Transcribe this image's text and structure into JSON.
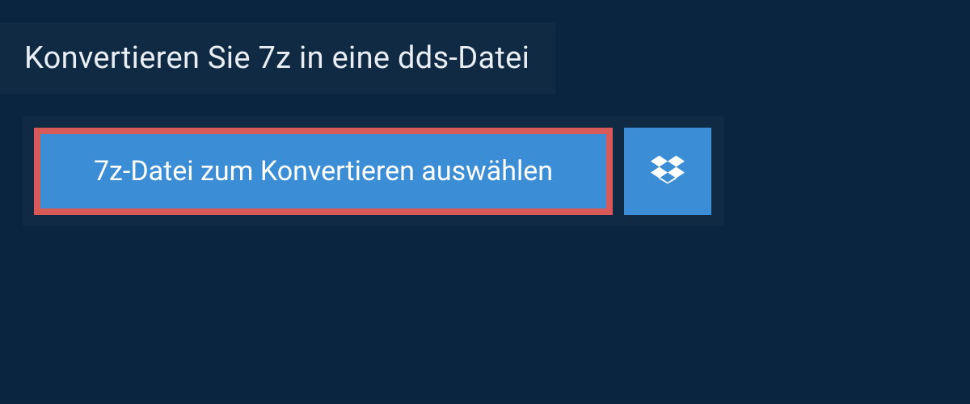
{
  "header": {
    "title": "Konvertieren Sie 7z in eine dds-Datei"
  },
  "actions": {
    "select_file_label": "7z-Datei zum Konvertieren auswählen",
    "dropbox_icon": "dropbox-icon"
  }
}
